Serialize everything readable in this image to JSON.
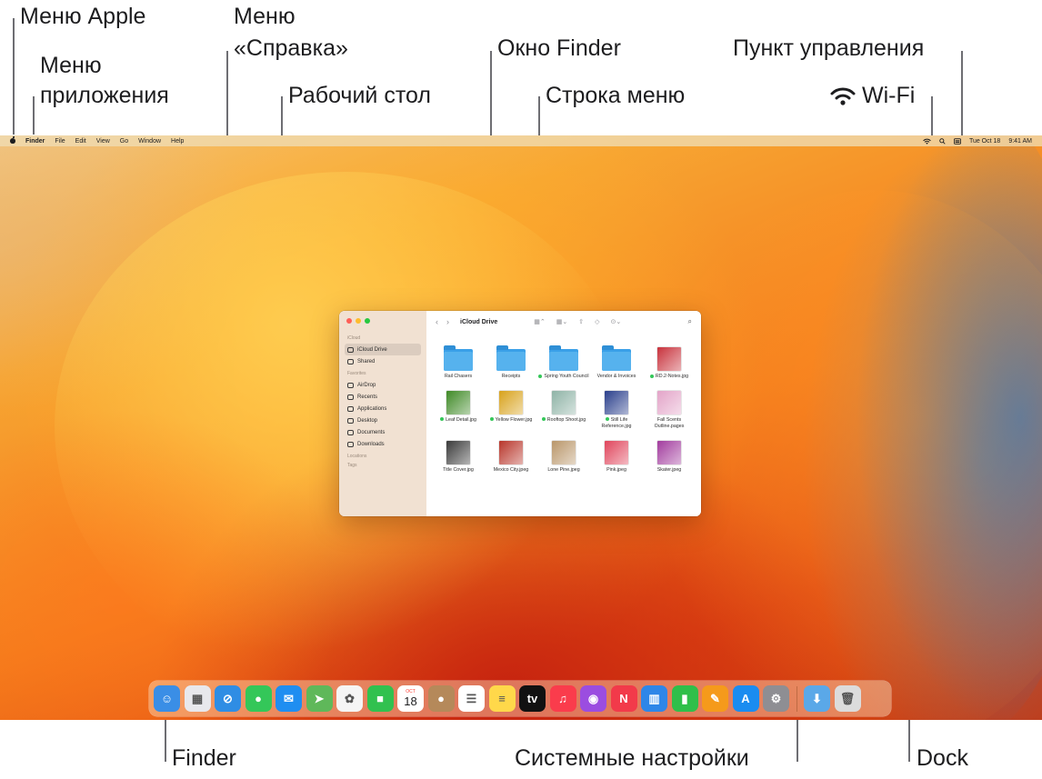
{
  "callouts": {
    "apple_menu": "Меню Apple",
    "app_menu_line1": "Меню",
    "app_menu_line2": "приложения",
    "help_menu_line1": "Меню",
    "help_menu_line2": "«Справка»",
    "desktop": "Рабочий стол",
    "finder_window": "Окно Finder",
    "menu_bar": "Строка меню",
    "control_center": "Пункт управления",
    "wifi": "Wi-Fi",
    "finder": "Finder",
    "system_settings": "Системные настройки",
    "dock": "Dock"
  },
  "menubar": {
    "app_name": "Finder",
    "items": [
      "File",
      "Edit",
      "View",
      "Go",
      "Window",
      "Help"
    ],
    "date": "Tue Oct 18",
    "time": "9:41 AM"
  },
  "finder_window": {
    "title": "iCloud Drive",
    "sidebar": {
      "sections": [
        {
          "title": "iCloud",
          "items": [
            {
              "label": "iCloud Drive",
              "active": true,
              "icon": "cloud-icon"
            },
            {
              "label": "Shared",
              "active": false,
              "icon": "shared-folder-icon"
            }
          ]
        },
        {
          "title": "Favorites",
          "items": [
            {
              "label": "AirDrop",
              "active": false,
              "icon": "airdrop-icon"
            },
            {
              "label": "Recents",
              "active": false,
              "icon": "clock-icon"
            },
            {
              "label": "Applications",
              "active": false,
              "icon": "applications-icon"
            },
            {
              "label": "Desktop",
              "active": false,
              "icon": "desktop-icon"
            },
            {
              "label": "Documents",
              "active": false,
              "icon": "document-icon"
            },
            {
              "label": "Downloads",
              "active": false,
              "icon": "download-icon"
            }
          ]
        },
        {
          "title": "Locations",
          "items": []
        },
        {
          "title": "Tags",
          "items": []
        }
      ]
    },
    "files": [
      {
        "name": "Rail Chasers",
        "kind": "folder",
        "tag": false,
        "color": ""
      },
      {
        "name": "Receipts",
        "kind": "folder",
        "tag": false,
        "color": ""
      },
      {
        "name": "Spring Youth Council",
        "kind": "folder",
        "tag": true,
        "color": ""
      },
      {
        "name": "Vendor & Invoices",
        "kind": "folder",
        "tag": false,
        "color": ""
      },
      {
        "name": "RD.2-Notes.jpg",
        "kind": "image",
        "tag": true,
        "color": "#c8323c"
      },
      {
        "name": "Leaf Detail.jpg",
        "kind": "image",
        "tag": true,
        "color": "#3f8a26"
      },
      {
        "name": "Yellow Flower.jpg",
        "kind": "image",
        "tag": true,
        "color": "#d8a21b"
      },
      {
        "name": "Rooftop Shoot.jpg",
        "kind": "image",
        "tag": true,
        "color": "#8fb3a6"
      },
      {
        "name": "Still Life Reference.jpg",
        "kind": "image",
        "tag": true,
        "color": "#2a3f8c"
      },
      {
        "name": "Fall Scents Outline.pages",
        "kind": "image",
        "tag": false,
        "color": "#e3a4c8"
      },
      {
        "name": "Title Cover.jpg",
        "kind": "image",
        "tag": false,
        "color": "#3a3a3a"
      },
      {
        "name": "Mexico City.jpeg",
        "kind": "image",
        "tag": false,
        "color": "#b8352a"
      },
      {
        "name": "Lone Pine.jpeg",
        "kind": "image",
        "tag": false,
        "color": "#b9966a"
      },
      {
        "name": "Pink.jpeg",
        "kind": "image",
        "tag": false,
        "color": "#e0455c"
      },
      {
        "name": "Skater.jpeg",
        "kind": "image",
        "tag": false,
        "color": "#a23c9e"
      }
    ]
  },
  "dock": {
    "apps": [
      {
        "name": "finder-icon",
        "color": "#3a8ee6",
        "glyph": "☺"
      },
      {
        "name": "launchpad-icon",
        "color": "#e8e8ec",
        "glyph": "▦"
      },
      {
        "name": "safari-icon",
        "color": "#2f8de4",
        "glyph": "⊘"
      },
      {
        "name": "messages-icon",
        "color": "#34c759",
        "glyph": "●"
      },
      {
        "name": "mail-icon",
        "color": "#1f8ef1",
        "glyph": "✉"
      },
      {
        "name": "maps-icon",
        "color": "#5fb85a",
        "glyph": "➤"
      },
      {
        "name": "photos-icon",
        "color": "#f5f5f5",
        "glyph": "✿"
      },
      {
        "name": "facetime-icon",
        "color": "#31c14f",
        "glyph": "■"
      },
      {
        "name": "calendar-icon",
        "color": "#ffffff",
        "glyph": ""
      },
      {
        "name": "contacts-icon",
        "color": "#b5895a",
        "glyph": "●"
      },
      {
        "name": "reminders-icon",
        "color": "#ffffff",
        "glyph": "☰"
      },
      {
        "name": "notes-icon",
        "color": "#ffd84a",
        "glyph": "≡"
      },
      {
        "name": "apple-tv-icon",
        "color": "#111111",
        "glyph": "tv"
      },
      {
        "name": "music-icon",
        "color": "#fa3c4c",
        "glyph": "♫"
      },
      {
        "name": "podcasts-icon",
        "color": "#9b4de0",
        "glyph": "◉"
      },
      {
        "name": "news-icon",
        "color": "#f23a4a",
        "glyph": "N"
      },
      {
        "name": "keynote-icon",
        "color": "#2e86e8",
        "glyph": "▥"
      },
      {
        "name": "numbers-icon",
        "color": "#2fbf4a",
        "glyph": "▮"
      },
      {
        "name": "pages-icon",
        "color": "#f59a1b",
        "glyph": "✎"
      },
      {
        "name": "app-store-icon",
        "color": "#1a8cf0",
        "glyph": "A"
      },
      {
        "name": "system-settings-icon",
        "color": "#8e8e93",
        "glyph": "⚙"
      }
    ],
    "calendar": {
      "month": "OCT",
      "day": "18"
    },
    "extras": [
      {
        "name": "downloads-folder-icon",
        "color": "#5aa8e8",
        "glyph": "⬇"
      },
      {
        "name": "trash-icon",
        "color": "#dcdcdc",
        "glyph": "🗑"
      }
    ]
  }
}
